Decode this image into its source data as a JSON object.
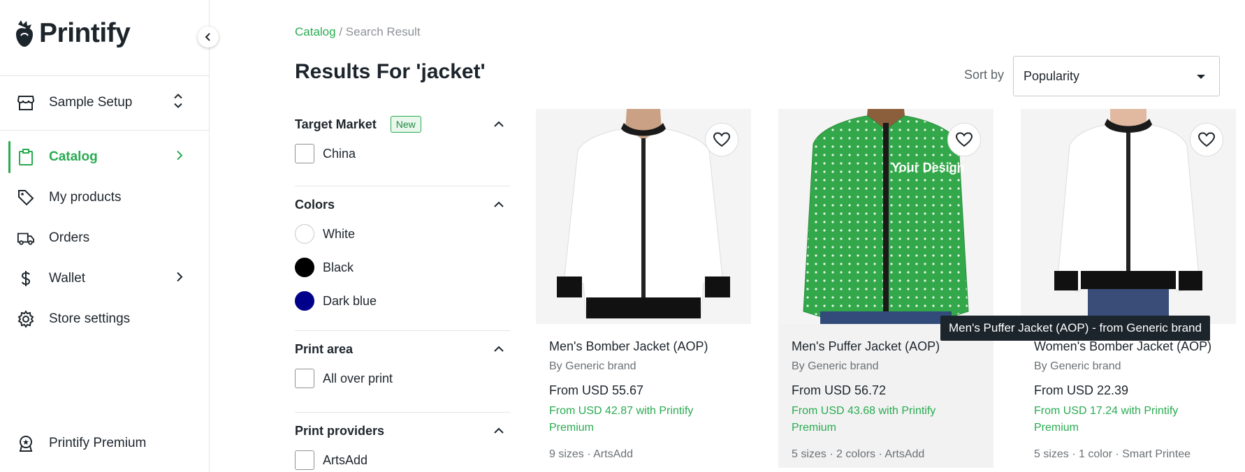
{
  "brand": {
    "name": "Printify"
  },
  "sidebar": {
    "store": {
      "label": "Sample Setup"
    },
    "items": [
      {
        "label": "Catalog"
      },
      {
        "label": "My products"
      },
      {
        "label": "Orders"
      },
      {
        "label": "Wallet"
      },
      {
        "label": "Store settings"
      }
    ],
    "premium": {
      "label": "Printify Premium"
    }
  },
  "breadcrumb": {
    "root": "Catalog",
    "separator": " / ",
    "current": "Search Result"
  },
  "title": "Results For 'jacket'",
  "sort": {
    "label": "Sort by",
    "value": "Popularity"
  },
  "filters": {
    "target_market": {
      "title": "Target Market",
      "badge": "New",
      "options": [
        "China"
      ]
    },
    "colors": {
      "title": "Colors",
      "options": [
        {
          "label": "White",
          "color": "#ffffff"
        },
        {
          "label": "Black",
          "color": "#000000"
        },
        {
          "label": "Dark blue",
          "color": "#00008b"
        }
      ]
    },
    "print_area": {
      "title": "Print area",
      "options": [
        "All over print"
      ]
    },
    "print_providers": {
      "title": "Print providers",
      "options": [
        "ArtsAdd"
      ]
    }
  },
  "products": [
    {
      "name": "Men's Bomber Jacket (AOP)",
      "brand": "By Generic brand",
      "price": "From USD 55.67",
      "premium": "From USD 42.87 with Printify Premium",
      "meta": "9 sizes · ArtsAdd"
    },
    {
      "name": "Men's Puffer Jacket (AOP)",
      "brand": "By Generic brand",
      "price": "From USD 56.72",
      "premium": "From USD 43.68 with Printify Premium",
      "meta": "5 sizes · 2 colors · ArtsAdd",
      "image_text": "Your Design"
    },
    {
      "name": "Women's Bomber Jacket (AOP)",
      "brand": "By Generic brand",
      "price": "From USD 22.39",
      "premium": "From USD 17.24 with Printify Premium",
      "meta": "5 sizes · 1 color · Smart Printee"
    }
  ],
  "tooltip": "Men's Puffer Jacket (AOP) - from Generic brand",
  "colors": {
    "accent": "#29ab51",
    "text": "#1d252c",
    "muted": "#6b7176"
  }
}
